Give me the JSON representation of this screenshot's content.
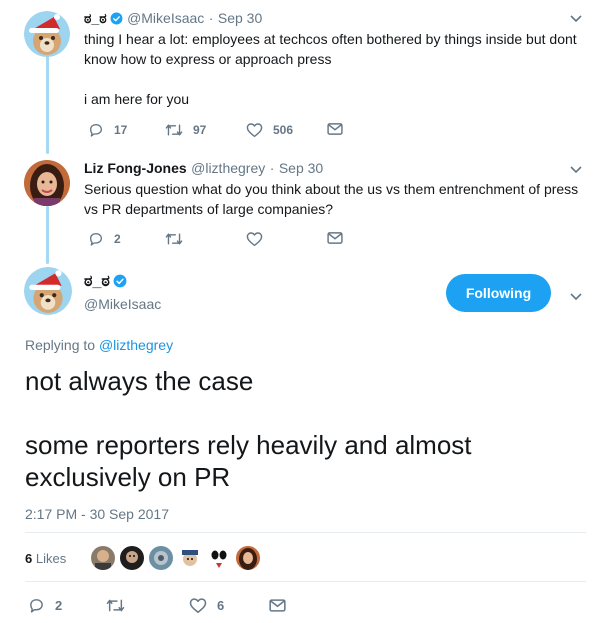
{
  "tweet1": {
    "name": "ಠ_ಠ",
    "handle": "@MikeIsaac",
    "dot": "·",
    "date": "Sep 30",
    "text_line1": "thing I hear a lot: employees at techcos often bothered by things inside but dont",
    "text_line2": "know how to express or approach press",
    "text_line3": "i am here for you",
    "replies": "17",
    "retweets": "97",
    "likes": "506"
  },
  "tweet2": {
    "name": "Liz Fong-Jones",
    "handle": "@lizthegrey",
    "dot": "·",
    "date": "Sep 30",
    "text_line1": "Serious question what do you think about the us vs them entrenchment of press",
    "text_line2": "vs PR departments of large companies?",
    "replies": "2"
  },
  "main": {
    "name": "ಠ_ಠ",
    "handle": "@MikeIsaac",
    "follow_label": "Following",
    "replying_prefix": "Replying to",
    "replying_handle": "@lizthegrey",
    "text_line1": "not always the case",
    "text_line2": "some reporters rely heavily and almost",
    "text_line3": "exclusively on PR",
    "timestamp": "2:17 PM - 30 Sep 2017",
    "likes_count": "6",
    "likes_label": "Likes",
    "replies": "2",
    "likes": "6"
  },
  "colors": {
    "accent": "#1da1f2",
    "link": "#1b95e0",
    "muted": "#657786",
    "thread_line": "#a5d8f3"
  },
  "icons": [
    "verified-badge-icon",
    "chevron-down-icon",
    "reply-icon",
    "retweet-icon",
    "heart-icon",
    "direct-message-icon"
  ]
}
